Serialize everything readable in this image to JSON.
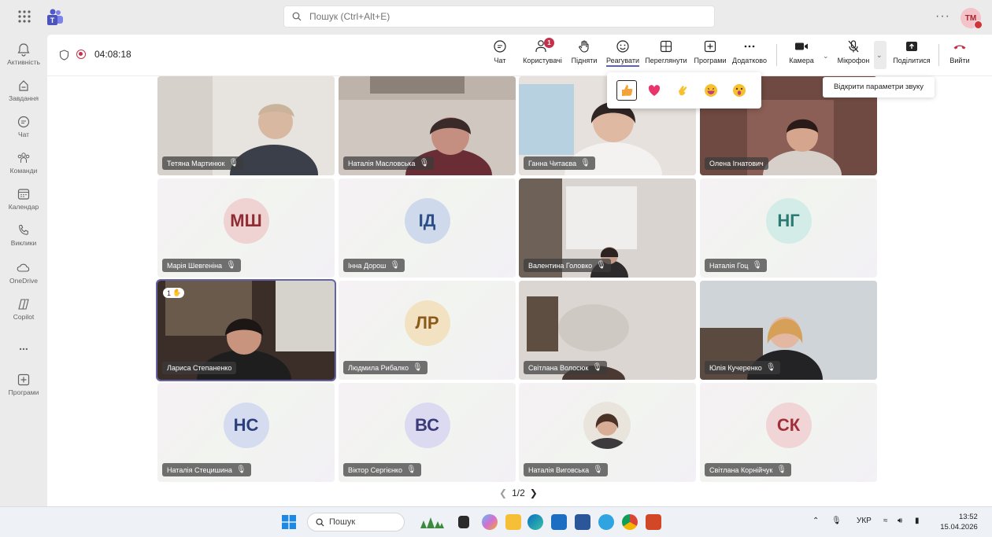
{
  "window": {
    "search_placeholder": "Пошук (Ctrl+Alt+E)",
    "user_initials": "TM"
  },
  "rail": [
    {
      "label": "Активність",
      "icon": "bell-icon"
    },
    {
      "label": "Завдання",
      "icon": "tasks-icon"
    },
    {
      "label": "Чат",
      "icon": "chat-icon"
    },
    {
      "label": "Команди",
      "icon": "teams-icon"
    },
    {
      "label": "Календар",
      "icon": "calendar-icon"
    },
    {
      "label": "Виклики",
      "icon": "phone-icon"
    },
    {
      "label": "OneDrive",
      "icon": "cloud-icon"
    },
    {
      "label": "Copilot",
      "icon": "copilot-icon"
    },
    {
      "label": "...",
      "icon": "more-icon"
    },
    {
      "label": "Програми",
      "icon": "plus-box-icon"
    }
  ],
  "meeting": {
    "timer": "04:08:18",
    "toolbar": {
      "chat": "Чат",
      "people": "Користувачі",
      "people_badge": "1",
      "raise": "Підняти",
      "react": "Реагувати",
      "view": "Переглянути",
      "apps": "Програми",
      "more": "Додатково",
      "camera": "Камера",
      "mic": "Мікрофон",
      "share": "Поділитися",
      "leave": "Вийти"
    },
    "tooltip": "Відкрити параметри звуку",
    "reactions": [
      "like",
      "heart",
      "applause",
      "laugh",
      "surprised"
    ],
    "participants": [
      {
        "name": "Тетяна Мартинюк",
        "muted": true,
        "video": true
      },
      {
        "name": "Наталія Масловська",
        "muted": true,
        "video": true
      },
      {
        "name": "Ганна Читаєва",
        "muted": true,
        "video": true
      },
      {
        "name": "Олена Ігнатович",
        "muted": false,
        "video": true
      },
      {
        "name": "Марія Шевгеніна",
        "muted": true,
        "initials": "МШ"
      },
      {
        "name": "Інна Дорош",
        "muted": true,
        "initials": "ІД"
      },
      {
        "name": "Валентина Головко",
        "muted": true,
        "video": true
      },
      {
        "name": "Наталія Гоц",
        "muted": true,
        "initials": "НГ"
      },
      {
        "name": "Лариса Степаненко",
        "muted": false,
        "video": true,
        "raised_hand": "1"
      },
      {
        "name": "Людмила Рибалко",
        "muted": true,
        "initials": "ЛР"
      },
      {
        "name": "Світлана Волосюк",
        "muted": true,
        "video": true
      },
      {
        "name": "Юлія Кучеренко",
        "muted": true,
        "video": true
      },
      {
        "name": "Наталія Стецишина",
        "muted": true,
        "initials": "НС"
      },
      {
        "name": "Віктор Сергієнко",
        "muted": true,
        "initials": "ВС"
      },
      {
        "name": "Наталія Виговська",
        "muted": true,
        "photo": true
      },
      {
        "name": "Світлана Корнійчук",
        "muted": true,
        "initials": "СК"
      }
    ],
    "pager": "1/2"
  },
  "taskbar": {
    "search": "Пошук",
    "lang": "УКР",
    "time": "13:52",
    "date": "15.04.2026"
  },
  "colors": {
    "accent": "#5b5fc7",
    "leave": "#c4314b"
  }
}
